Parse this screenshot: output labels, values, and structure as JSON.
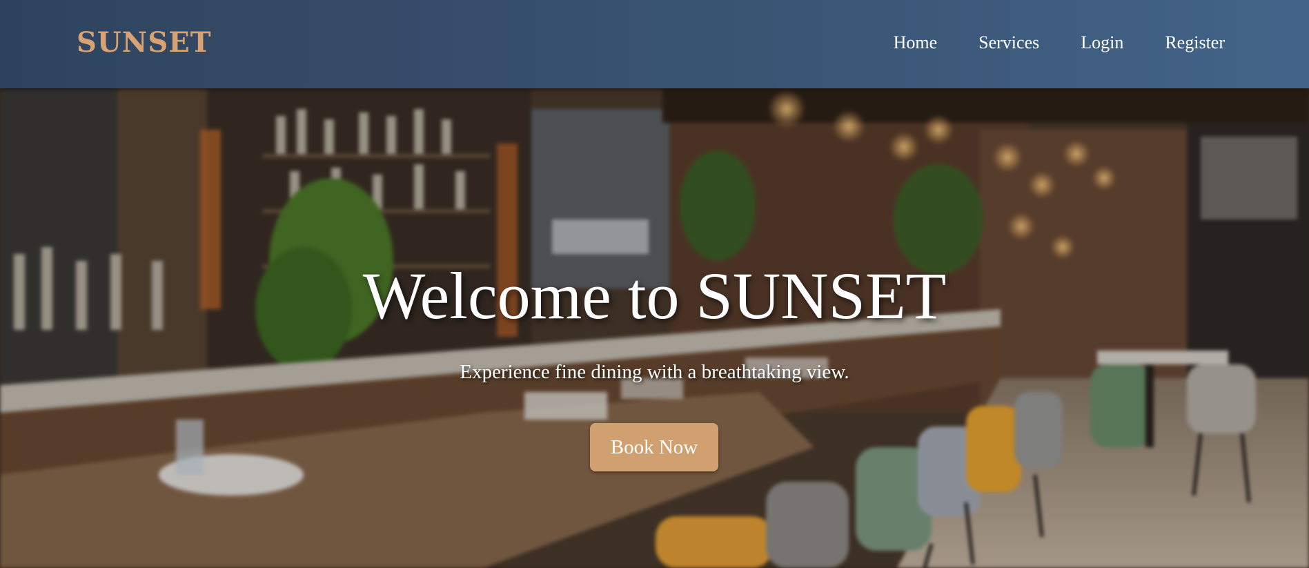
{
  "navbar": {
    "logo": "SUNSET",
    "links": [
      "Home",
      "Services",
      "Login",
      "Register"
    ]
  },
  "hero": {
    "title": "Welcome to SUNSET",
    "subtitle": "Experience fine dining with a breathtaking view.",
    "cta_label": "Book Now",
    "background": "restaurant-interior-photo"
  },
  "colors": {
    "nav_bg": "#3a5575",
    "logo": "#d9a273",
    "cta_bg": "#d1a070",
    "text": "#ffffff"
  }
}
